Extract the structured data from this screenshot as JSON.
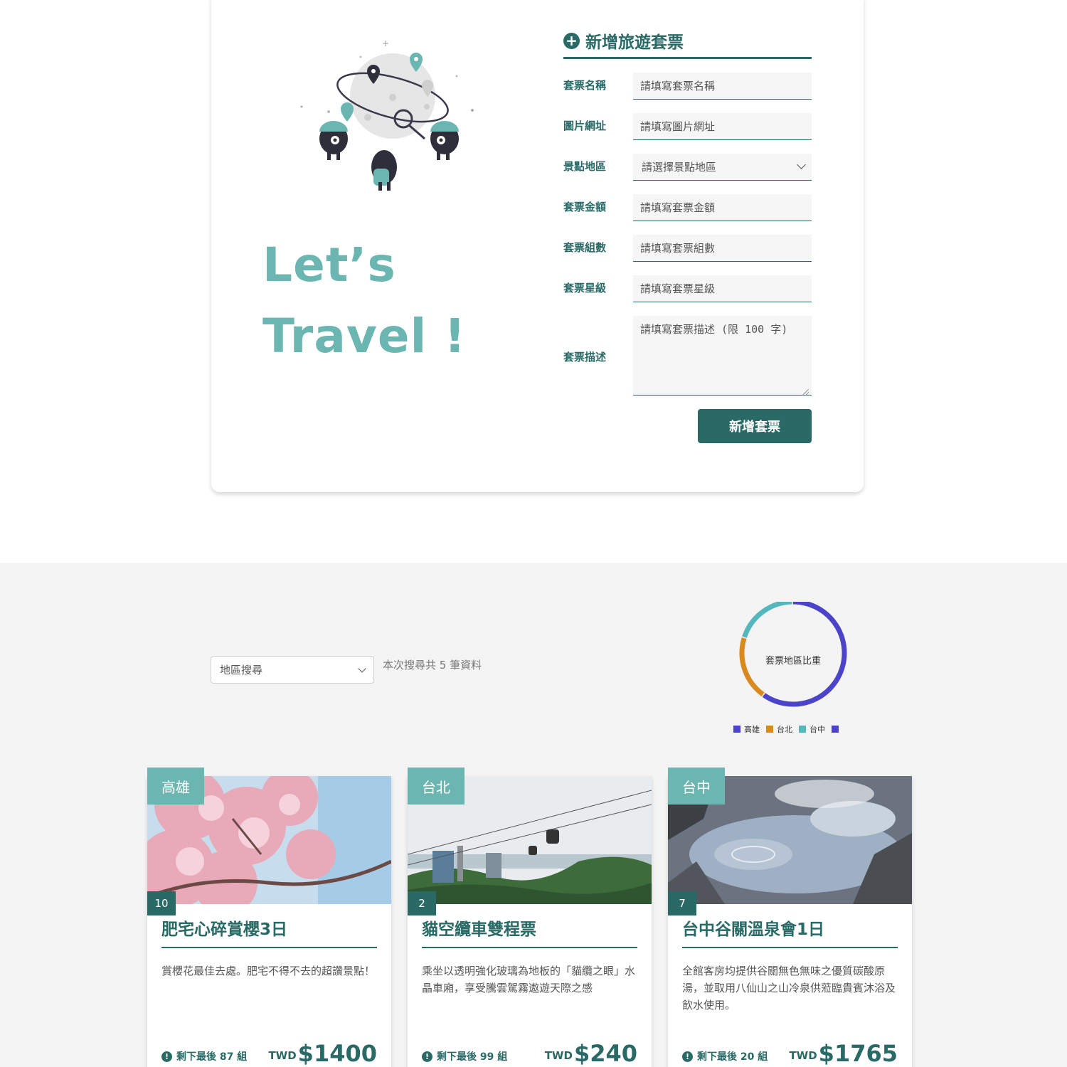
{
  "form": {
    "title": "新增旅遊套票",
    "hero_line1": "Let’s",
    "hero_line2": "Travel !",
    "fields": [
      {
        "label": "套票名稱",
        "placeholder": "請填寫套票名稱"
      },
      {
        "label": "圖片網址",
        "placeholder": "請填寫圖片網址"
      },
      {
        "label": "景點地區",
        "placeholder": "請選擇景點地區"
      },
      {
        "label": "套票金額",
        "placeholder": "請填寫套票金額"
      },
      {
        "label": "套票組數",
        "placeholder": "請填寫套票組數"
      },
      {
        "label": "套票星級",
        "placeholder": "請填寫套票星級"
      },
      {
        "label": "套票描述",
        "placeholder": "請填寫套票描述 (限 100 字)"
      }
    ],
    "submit_label": "新增套票"
  },
  "search": {
    "select_value": "地區搜尋",
    "result_text": "本次搜尋共 5 筆資料"
  },
  "chart_data": {
    "type": "pie",
    "title": "套票地區比重",
    "categories": [
      "高雄",
      "台北",
      "台中"
    ],
    "values": [
      3,
      1,
      1
    ],
    "colors": [
      "#4c44c8",
      "#d98a1f",
      "#53b7bd"
    ],
    "legend_position": "bottom"
  },
  "cards": [
    {
      "area": "高雄",
      "rank": "10",
      "title": "肥宅心碎賞櫻3日",
      "description": "賞櫻花最佳去處。肥宅不得不去的超讚景點！",
      "remaining": "剩下最後 87 組",
      "currency": "TWD",
      "price": "$1400"
    },
    {
      "area": "台北",
      "rank": "2",
      "title": "貓空纜車雙程票",
      "description": "乘坐以透明強化玻璃為地板的「貓纜之眼」水晶車廂，享受騰雲駕霧遨遊天際之感",
      "remaining": "剩下最後 99 組",
      "currency": "TWD",
      "price": "$240"
    },
    {
      "area": "台中",
      "rank": "7",
      "title": "台中谷關溫泉會1日",
      "description": "全館客房均提供谷關無色無味之優質碳酸原湯，並取用八仙山之山冷泉供蒞臨貴賓沐浴及飲水使用。",
      "remaining": "剩下最後 20 組",
      "currency": "TWD",
      "price": "$1765"
    }
  ]
}
